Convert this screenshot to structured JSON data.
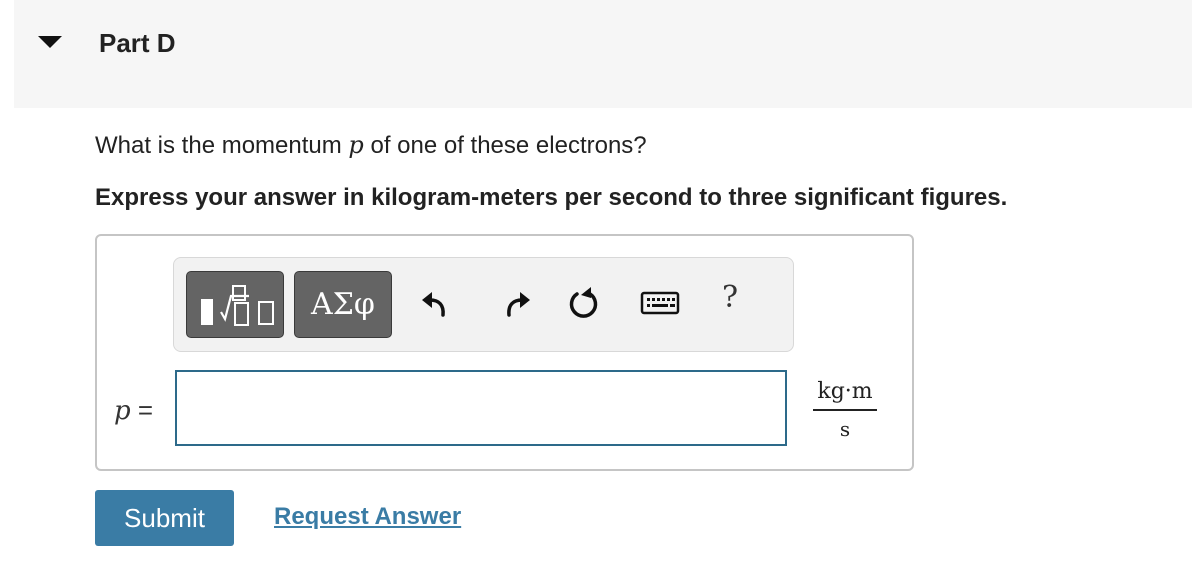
{
  "part": {
    "title": "Part D"
  },
  "question": {
    "prefix": "What is the momentum ",
    "variable": "p",
    "suffix": " of one of these electrons?",
    "instruction": "Express your answer in kilogram-meters per second to three significant figures."
  },
  "toolbar": {
    "greek_label": "ΑΣφ",
    "help_label": "?",
    "icons": [
      "templates-icon",
      "greek-letters-icon",
      "undo-icon",
      "redo-icon",
      "reset-icon",
      "keyboard-icon",
      "help-icon"
    ]
  },
  "answer": {
    "variable": "p",
    "equals": " =",
    "value": "",
    "unit_numerator": "kg·m",
    "unit_denominator": "s"
  },
  "actions": {
    "submit_label": "Submit",
    "request_label": "Request Answer"
  },
  "colors": {
    "header_bg": "#f6f6f6",
    "accent": "#3a7ca5",
    "input_border": "#2d6a8a",
    "toolbar_button": "#646464"
  }
}
